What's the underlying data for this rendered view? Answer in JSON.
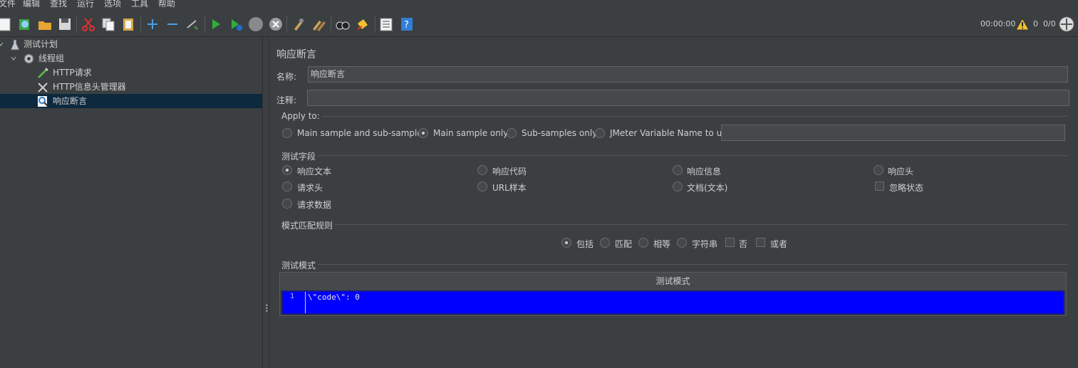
{
  "menu": [
    "文件",
    "编辑",
    "查找",
    "运行",
    "选项",
    "工具",
    "帮助"
  ],
  "toolbar": {
    "icons": [
      "new-icon",
      "templates-icon",
      "open-icon",
      "save-icon",
      "cut-icon",
      "copy-icon",
      "paste-icon",
      "expand-icon",
      "collapse-icon",
      "toggle-icon",
      "start-icon",
      "start-no-pause-icon",
      "stop-icon",
      "shutdown-icon",
      "clear-icon",
      "clear-all-icon",
      "search-icon",
      "reset-search-icon",
      "function-helper-icon",
      "help-icon"
    ],
    "timer": "00:00:00",
    "warning_count": "0",
    "thread_count": "0/0"
  },
  "tree": {
    "items": [
      {
        "label": "测试计划",
        "icon": "test-plan-icon"
      },
      {
        "label": "线程组",
        "icon": "gear-icon"
      },
      {
        "label": "HTTP请求",
        "icon": "pipette-icon"
      },
      {
        "label": "HTTP信息头管理器",
        "icon": "wrench-icon"
      },
      {
        "label": "响应断言",
        "icon": "magnifier-icon"
      }
    ]
  },
  "panel": {
    "title": "响应断言",
    "name_label": "名称:",
    "name_value": "响应断言",
    "comment_label": "注释:",
    "comment_value": "",
    "apply_to": {
      "title": "Apply to:",
      "options": [
        "Main sample and sub-samples",
        "Main sample only",
        "Sub-samples only",
        "JMeter Variable Name to use"
      ],
      "selected": "Main sample only",
      "variable_value": ""
    },
    "field_to_test": {
      "title": "测试字段",
      "options": [
        "响应文本",
        "响应代码",
        "响应信息",
        "响应头",
        "请求头",
        "URL样本",
        "文档(文本)",
        "忽略状态",
        "请求数据"
      ],
      "selected": "响应文本",
      "ignore_status_checked": false
    },
    "pattern_rules": {
      "title": "模式匹配规则",
      "options": [
        "包括",
        "匹配",
        "相等",
        "字符串",
        "否",
        "或者"
      ],
      "selected": "包括"
    },
    "patterns": {
      "title": "测试模式",
      "column_header": "测试模式",
      "lines": [
        {
          "no": "1",
          "text": "\\\"code\\\": 0"
        }
      ]
    }
  },
  "colors": {
    "background": "#3c3f41",
    "selection": "#0d293e",
    "editor_bg": "#0000ff"
  }
}
